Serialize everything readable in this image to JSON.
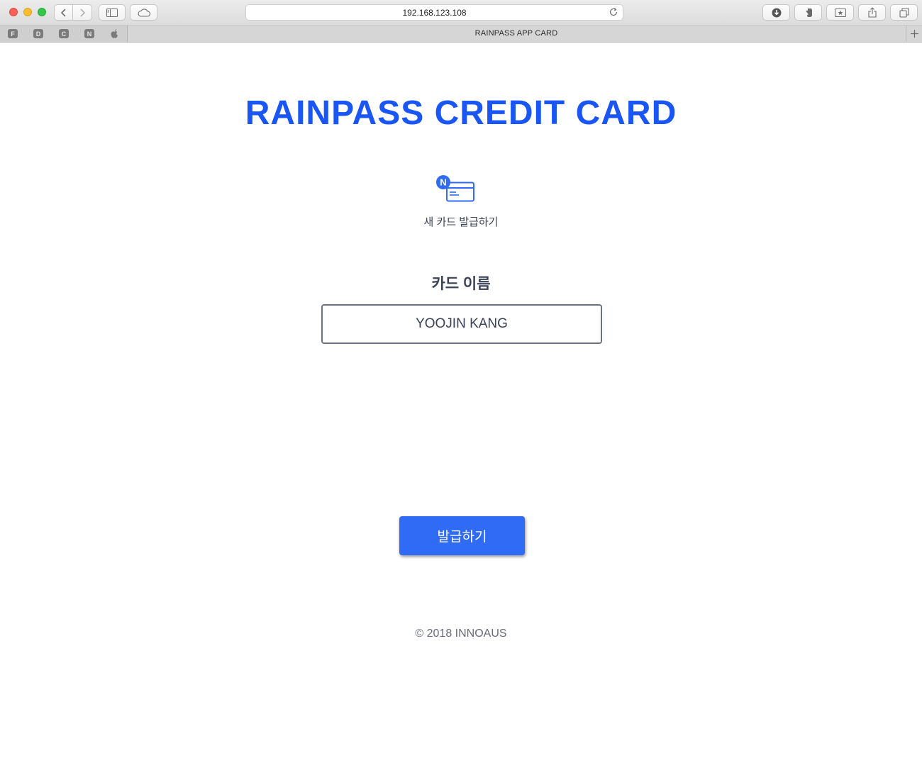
{
  "browser": {
    "url": "192.168.123.108",
    "tab_title": "RAINPASS APP CARD",
    "favorites": [
      "F",
      "D",
      "C",
      "N"
    ],
    "icons": [
      "back-icon",
      "forward-icon",
      "sidebar-icon",
      "icloud-icon",
      "reload-icon",
      "download-icon",
      "evernote-icon",
      "bookmark-icon",
      "share-icon",
      "tabs-icon",
      "apple-icon",
      "new-tab-icon"
    ]
  },
  "page": {
    "title": "RAINPASS CREDIT CARD",
    "new_card": {
      "badge": "N",
      "label": "새 카드 발급하기",
      "icon": "credit-card-icon"
    },
    "card_name": {
      "label": "카드 이름",
      "value": "YOOJIN KANG"
    },
    "issue_button": "발급하기",
    "footer": "© 2018 INNOAUS"
  },
  "colors": {
    "accent": "#1a56f5",
    "button": "#2f6bf4",
    "text": "#3b4156"
  }
}
